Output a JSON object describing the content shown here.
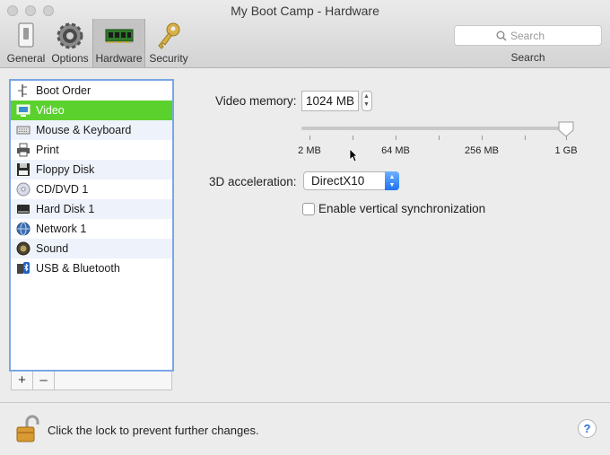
{
  "window": {
    "title": "My Boot Camp - Hardware"
  },
  "toolbar": {
    "items": [
      {
        "label": "General",
        "icon": "switch-icon"
      },
      {
        "label": "Options",
        "icon": "gear-icon"
      },
      {
        "label": "Hardware",
        "icon": "memory-chip-icon",
        "selected": true
      },
      {
        "label": "Security",
        "icon": "key-icon"
      }
    ],
    "search": {
      "placeholder": "Search",
      "caption": "Search"
    }
  },
  "sidebar": {
    "items": [
      {
        "label": "Boot Order",
        "icon": "boot-order-icon"
      },
      {
        "label": "Video",
        "icon": "display-icon",
        "selected": true
      },
      {
        "label": "Mouse & Keyboard",
        "icon": "keyboard-icon"
      },
      {
        "label": "Print",
        "icon": "printer-icon"
      },
      {
        "label": "Floppy Disk",
        "icon": "floppy-disk-icon"
      },
      {
        "label": "CD/DVD 1",
        "icon": "cd-dvd-icon"
      },
      {
        "label": "Hard Disk 1",
        "icon": "hard-disk-icon"
      },
      {
        "label": "Network 1",
        "icon": "network-globe-icon"
      },
      {
        "label": "Sound",
        "icon": "speaker-icon"
      },
      {
        "label": "USB & Bluetooth",
        "icon": "usb-bluetooth-icon"
      }
    ],
    "add_label": "+",
    "remove_label": "–"
  },
  "video": {
    "memory_label": "Video memory:",
    "memory_value": "1024 MB",
    "slider": {
      "ticks": [
        "2 MB",
        "64 MB",
        "256 MB",
        "1 GB"
      ],
      "value": "1 GB"
    },
    "acceleration_label": "3D acceleration:",
    "acceleration_value": "DirectX10",
    "vsync_label": "Enable vertical synchronization",
    "vsync_checked": false
  },
  "footer": {
    "lock_text": "Click the lock to prevent further changes.",
    "help_label": "?"
  },
  "colors": {
    "selection": "#5bd12e",
    "accent": "#1f73f0"
  }
}
